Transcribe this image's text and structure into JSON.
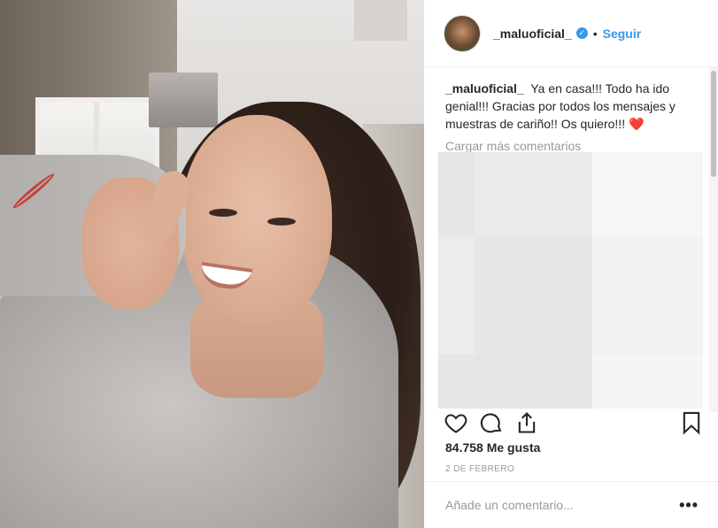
{
  "post": {
    "username": "_maluoficial_",
    "verified_icon": "verified-badge-icon",
    "separator": "•",
    "follow_label": "Seguir"
  },
  "caption": {
    "username": "_maluoficial_",
    "text": "Ya en casa!!! Todo ha ido genial!!! Gracias por todos los mensajes y muestras de cariño!! Os quiero!!!",
    "emoji": "❤️"
  },
  "comments": {
    "load_more": "Cargar más comentarios"
  },
  "actions": {
    "like_icon": "heart-icon",
    "comment_icon": "comment-icon",
    "share_icon": "share-icon",
    "save_icon": "bookmark-icon"
  },
  "likes": "84.758 Me gusta",
  "date": "2 DE FEBRERO",
  "comment_box": {
    "placeholder": "Añade un comentario...",
    "more_label": "•••"
  },
  "colors": {
    "link": "#3897f0",
    "text": "#262626",
    "muted": "#999999"
  }
}
